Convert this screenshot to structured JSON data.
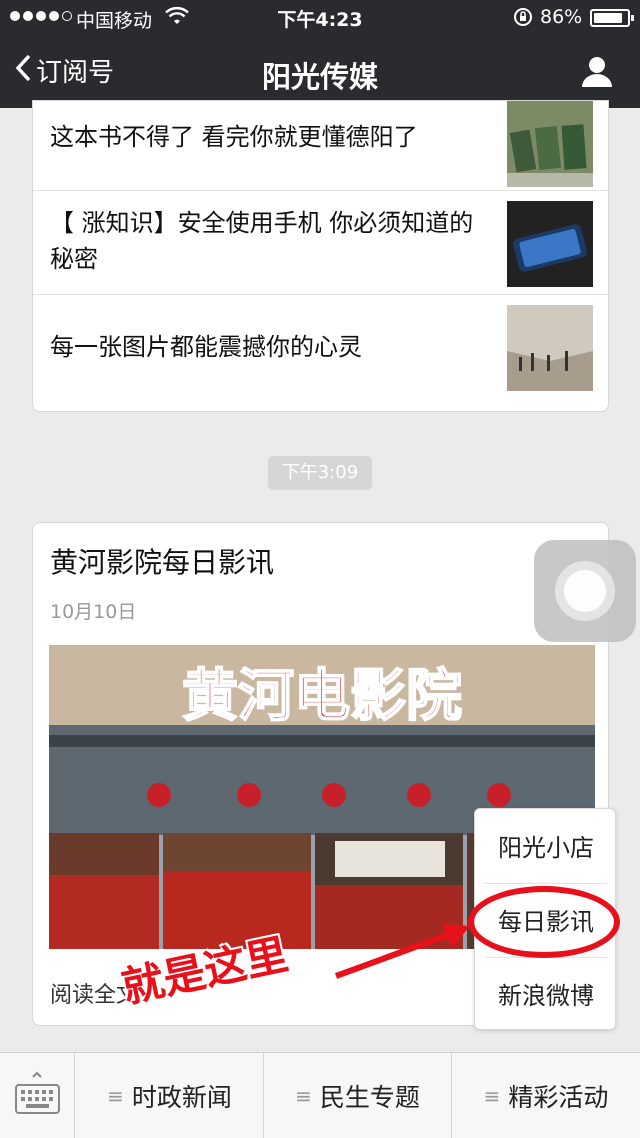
{
  "status_bar": {
    "carrier": "中国移动",
    "time": "下午4:23",
    "battery": "86%"
  },
  "nav": {
    "back_label": "订阅号",
    "title": "阳光传媒"
  },
  "articles": [
    {
      "title": "这本书不得了  看完你就更懂德阳了"
    },
    {
      "title": "【 涨知识】安全使用手机 你必须知道的秘密"
    },
    {
      "title": "每一张图片都能震撼你的心灵"
    }
  ],
  "timestamp": "下午3:09",
  "featured": {
    "title": "黄河影院每日影讯",
    "date": "10月10日",
    "image_banner": "黄河电影院",
    "read_more": "阅读全文"
  },
  "popup_menu": {
    "items": [
      "阳光小店",
      "每日影讯",
      "新浪微博"
    ]
  },
  "annotation": {
    "text": "就是这里"
  },
  "bottom_menu": {
    "tabs": [
      "时政新闻",
      "民生专题",
      "精彩活动"
    ]
  },
  "colors": {
    "nav_bg": "#2a2b2f",
    "annotation_red": "#e8101a"
  }
}
